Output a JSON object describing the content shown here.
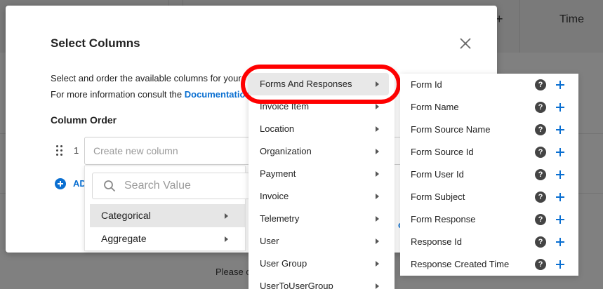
{
  "background": {
    "time_header": "Time",
    "plus_glyph": "+",
    "please_text": "Please c"
  },
  "modal": {
    "title": "Select Columns",
    "desc_line1": "Select and order the available columns for your",
    "desc_line2_prefix": "For more information consult the ",
    "desc_line2_link": "Documentation",
    "column_order_title": "Column Order",
    "row_number": "1",
    "new_column_placeholder": "Create new column",
    "add_label": "ADD",
    "partial_link": "cc"
  },
  "search_dropdown": {
    "placeholder": "Search Value",
    "items": [
      {
        "label": "Categorical",
        "active": true
      },
      {
        "label": "Aggregate",
        "active": false
      }
    ]
  },
  "category_menu": {
    "items": [
      {
        "label": "Forms And Responses",
        "active": true
      },
      {
        "label": "Invoice Item",
        "active": false
      },
      {
        "label": "Location",
        "active": false
      },
      {
        "label": "Organization",
        "active": false
      },
      {
        "label": "Payment",
        "active": false
      },
      {
        "label": "Invoice",
        "active": false
      },
      {
        "label": "Telemetry",
        "active": false
      },
      {
        "label": "User",
        "active": false
      },
      {
        "label": "User Group",
        "active": false
      },
      {
        "label": "UserToUserGroup",
        "active": false
      }
    ]
  },
  "field_menu": {
    "help_glyph": "?",
    "items": [
      {
        "label": "Form Id"
      },
      {
        "label": "Form Name"
      },
      {
        "label": "Form Source Name"
      },
      {
        "label": "Form Source Id"
      },
      {
        "label": "Form User Id"
      },
      {
        "label": "Form Subject"
      },
      {
        "label": "Form Response"
      },
      {
        "label": "Response Id"
      },
      {
        "label": "Response Created Time"
      }
    ]
  },
  "colors": {
    "accent": "#0a6fd1",
    "highlight": "#ff0000",
    "overlay": "#808080"
  }
}
